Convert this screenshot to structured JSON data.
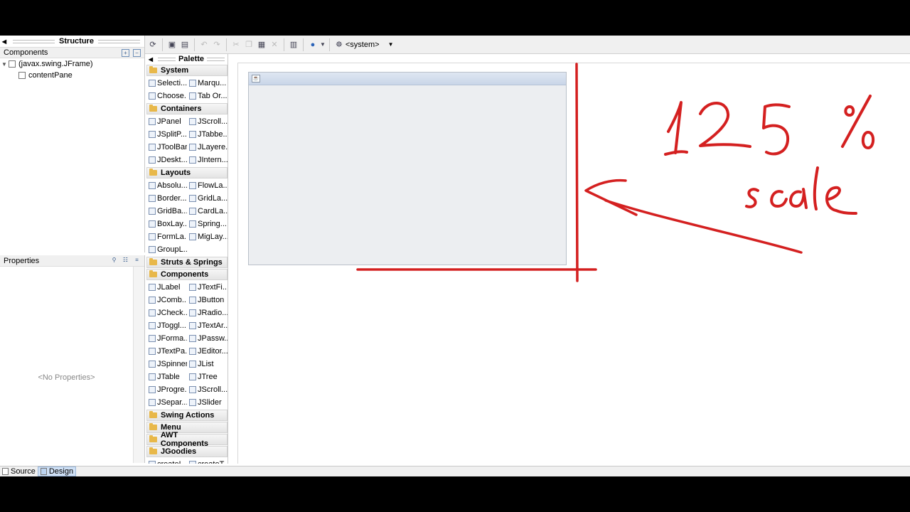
{
  "structure": {
    "title": "Structure",
    "components_label": "Components",
    "tree": [
      {
        "label": "(javax.swing.JFrame)",
        "level": 0
      },
      {
        "label": "contentPane",
        "level": 1
      }
    ]
  },
  "properties": {
    "title": "Properties",
    "empty_text": "<No Properties>"
  },
  "toolbar": {
    "look_and_feel": "<system>"
  },
  "palette": {
    "title": "Palette",
    "categories": [
      {
        "name": "System",
        "items": [
          "Selecti...",
          "Marqu...",
          "Choose...",
          "Tab Or..."
        ]
      },
      {
        "name": "Containers",
        "items": [
          "JPanel",
          "JScroll...",
          "JSplitP...",
          "JTabbe...",
          "JToolBar",
          "JLayere...",
          "JDeskt...",
          "JIntern..."
        ]
      },
      {
        "name": "Layouts",
        "items": [
          "Absolu...",
          "FlowLa...",
          "Border...",
          "GridLa...",
          "GridBa...",
          "CardLa...",
          "BoxLay...",
          "Spring...",
          "FormLa...",
          "MigLay...",
          "GroupL..."
        ]
      },
      {
        "name": "Struts & Springs",
        "items": []
      },
      {
        "name": "Components",
        "items": [
          "JLabel",
          "JTextFi...",
          "JComb...",
          "JButton",
          "JCheck...",
          "JRadio...",
          "JToggl...",
          "JTextAr...",
          "JForma...",
          "JPassw...",
          "JTextPa...",
          "JEditor...",
          "JSpinner",
          "JList",
          "JTable",
          "JTree",
          "JProgre...",
          "JScroll...",
          "JSepar...",
          "JSlider"
        ]
      },
      {
        "name": "Swing Actions",
        "items": []
      },
      {
        "name": "Menu",
        "items": []
      },
      {
        "name": "AWT Components",
        "items": []
      },
      {
        "name": "JGoodies",
        "items": [
          "createL...",
          "createT..."
        ]
      }
    ]
  },
  "bottom_tabs": [
    "Source",
    "Design"
  ],
  "annotation": {
    "handwriting": [
      "125 %",
      "scale"
    ],
    "color": "#d42020"
  }
}
